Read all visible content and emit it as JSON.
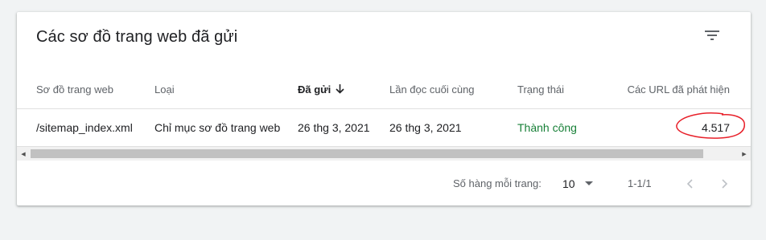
{
  "card": {
    "title": "Các sơ đồ trang web đã gửi",
    "filter_icon": "filter-list-icon"
  },
  "table": {
    "columns": [
      "Sơ đồ trang web",
      "Loại",
      "Đã gửi",
      "Lần đọc cuối cùng",
      "Trạng thái",
      "Các URL đã phát hiện"
    ],
    "sorted_column": "Đã gửi",
    "sort_direction": "descending",
    "rows": [
      {
        "sitemap": "/sitemap_index.xml",
        "type": "Chỉ mục sơ đồ trang web",
        "submitted": "26 thg 3, 2021",
        "last_read": "26 thg 3, 2021",
        "status": "Thành công",
        "discovered_urls": "4.517"
      }
    ]
  },
  "pagination": {
    "rows_per_page_label": "Số hàng mỗi trang:",
    "rows_per_page_value": "10",
    "range": "1-1/1"
  },
  "colors": {
    "status_success": "#188038",
    "annotation_circle": "#e8202a"
  }
}
